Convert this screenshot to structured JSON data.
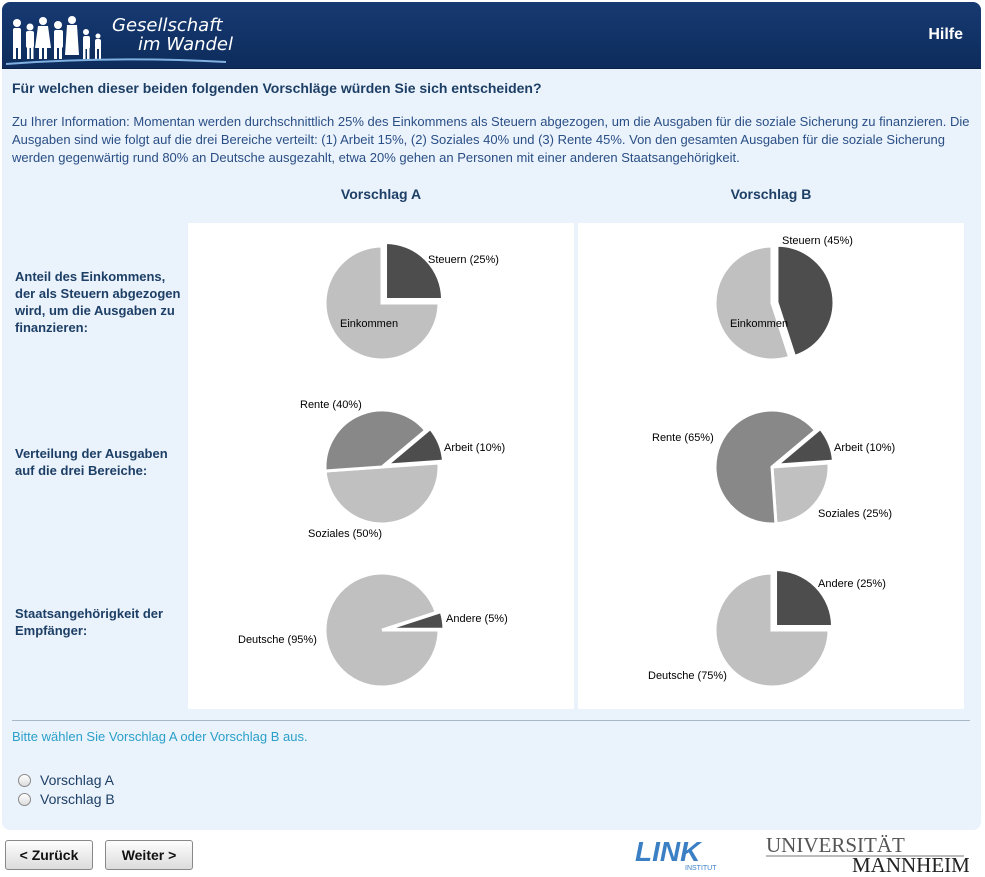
{
  "header": {
    "logo_line1": "Gesellschaft",
    "logo_line2": "im Wandel",
    "help_label": "Hilfe"
  },
  "question": "Für welchen dieser beiden folgenden Vorschläge würden Sie sich entscheiden?",
  "info_text": "Zu Ihrer Information: Momentan werden durchschnittlich 25% des Einkommens als Steuern abgezogen, um die Ausgaben für die soziale Sicherung zu finanzieren. Die Ausgaben sind wie folgt auf die drei Bereiche verteilt: (1) Arbeit 15%, (2) Soziales 40% und (3) Rente 45%. Von den gesamten Ausgaben für die soziale Sicherung werden gegenwärtig rund 80% an Deutsche ausgezahlt, etwa 20% gehen an Personen mit einer anderen Staatsangehörigkeit.",
  "columns": {
    "a": "Vorschlag A",
    "b": "Vorschlag B"
  },
  "rows": {
    "tax": "Anteil des Einkommens, der als Steuern abgezogen wird, um die Ausgaben zu finanzieren:",
    "spending": "Verteilung der Ausgaben auf die drei Bereiche:",
    "nationality": "Staatsangehörigkeit der Empfänger:"
  },
  "colors": {
    "dark": "#4d4d4d",
    "mid": "#888888",
    "light": "#c0c0c0",
    "header": "#0d2c5c",
    "accent_text": "#2aa0c9"
  },
  "chart_data": [
    {
      "type": "pie",
      "proposal": "Vorschlag A",
      "row": "tax",
      "slices": [
        {
          "label": "Steuern (25%)",
          "value": 25,
          "shade": "dark"
        },
        {
          "label": "Einkommen",
          "value": 75,
          "shade": "light"
        }
      ]
    },
    {
      "type": "pie",
      "proposal": "Vorschlag B",
      "row": "tax",
      "slices": [
        {
          "label": "Steuern (45%)",
          "value": 45,
          "shade": "dark"
        },
        {
          "label": "Einkommen",
          "value": 55,
          "shade": "light"
        }
      ]
    },
    {
      "type": "pie",
      "proposal": "Vorschlag A",
      "row": "spending",
      "slices": [
        {
          "label": "Arbeit (10%)",
          "value": 10,
          "shade": "dark"
        },
        {
          "label": "Soziales (50%)",
          "value": 50,
          "shade": "light"
        },
        {
          "label": "Rente (40%)",
          "value": 40,
          "shade": "mid"
        }
      ]
    },
    {
      "type": "pie",
      "proposal": "Vorschlag B",
      "row": "spending",
      "slices": [
        {
          "label": "Arbeit (10%)",
          "value": 10,
          "shade": "dark"
        },
        {
          "label": "Soziales (25%)",
          "value": 25,
          "shade": "light"
        },
        {
          "label": "Rente (65%)",
          "value": 65,
          "shade": "mid"
        }
      ]
    },
    {
      "type": "pie",
      "proposal": "Vorschlag A",
      "row": "nationality",
      "slices": [
        {
          "label": "Andere (5%)",
          "value": 5,
          "shade": "dark"
        },
        {
          "label": "Deutsche (95%)",
          "value": 95,
          "shade": "light"
        }
      ]
    },
    {
      "type": "pie",
      "proposal": "Vorschlag B",
      "row": "nationality",
      "slices": [
        {
          "label": "Andere (25%)",
          "value": 25,
          "shade": "dark"
        },
        {
          "label": "Deutsche (75%)",
          "value": 75,
          "shade": "light"
        }
      ]
    }
  ],
  "instruction": "Bitte wählen Sie Vorschlag A oder Vorschlag B aus.",
  "options": {
    "a": "Vorschlag A",
    "b": "Vorschlag B"
  },
  "nav": {
    "back": "< Zurück",
    "next": "Weiter >"
  },
  "logos": {
    "link": "LINK",
    "link_sub": "INSTITUT",
    "uni_line1": "UNIVERSITÄT",
    "uni_line2": "MANNHEIM"
  }
}
